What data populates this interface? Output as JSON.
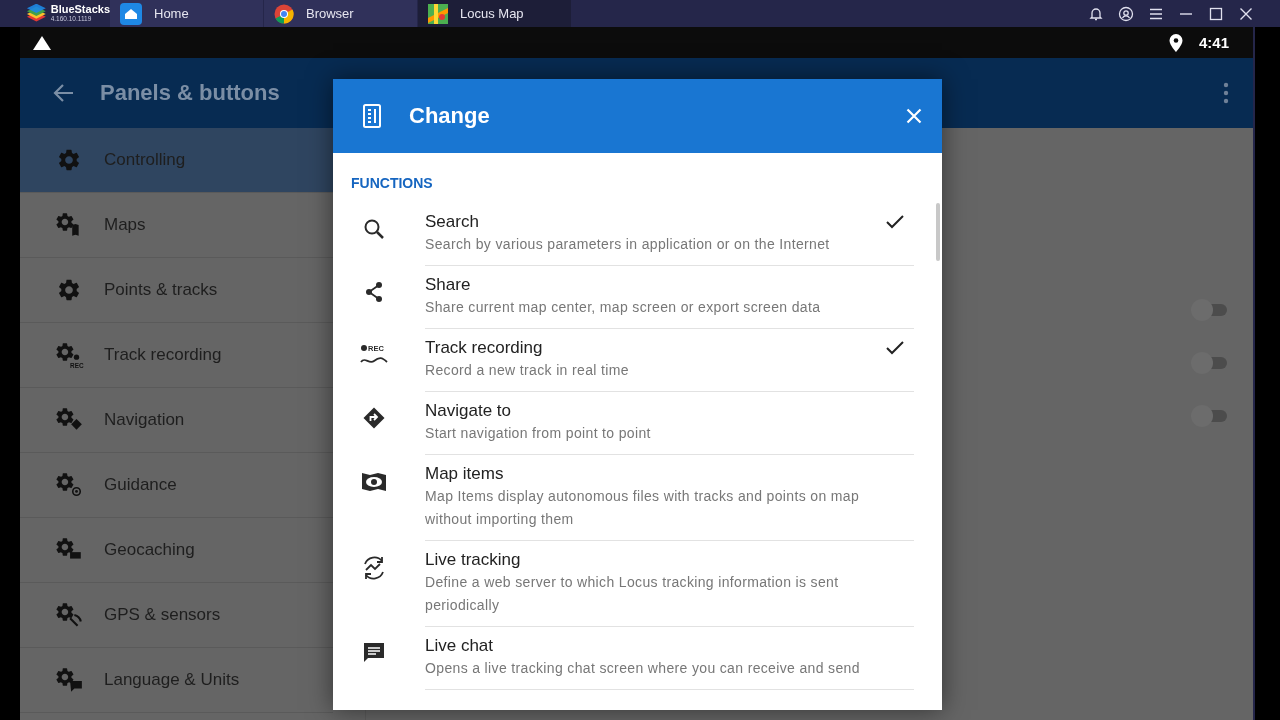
{
  "emulator": {
    "app_name": "BlueStacks",
    "version": "4.160.10.1119",
    "tabs": [
      {
        "label": "Home",
        "selected": false
      },
      {
        "label": "Browser",
        "selected": false
      },
      {
        "label": "Locus Map",
        "selected": true
      }
    ]
  },
  "status_bar": {
    "time": "4:41"
  },
  "app_bar": {
    "title": "Panels & buttons"
  },
  "sidebar": {
    "items": [
      {
        "label": "Controlling",
        "selected": true
      },
      {
        "label": "Maps",
        "selected": false
      },
      {
        "label": "Points & tracks",
        "selected": false
      },
      {
        "label": "Track recording",
        "selected": false,
        "badge": "REC"
      },
      {
        "label": "Navigation",
        "selected": false
      },
      {
        "label": "Guidance",
        "selected": false
      },
      {
        "label": "Geocaching",
        "selected": false
      },
      {
        "label": "GPS & sensors",
        "selected": false
      },
      {
        "label": "Language & Units",
        "selected": false
      }
    ]
  },
  "toggles": [
    {
      "on": false
    },
    {
      "on": false
    },
    {
      "on": false
    }
  ],
  "dialog": {
    "title": "Change",
    "section": "FUNCTIONS",
    "items": [
      {
        "title": "Search",
        "description": "Search by various parameters in application or on the Internet",
        "checked": true
      },
      {
        "title": "Share",
        "description": "Share current map center, map screen or export screen data",
        "checked": false
      },
      {
        "title": "Track recording",
        "description": "Record a new track in real time",
        "checked": true,
        "badge": "REC"
      },
      {
        "title": "Navigate to",
        "description": "Start navigation from point to point",
        "checked": false
      },
      {
        "title": "Map items",
        "description": "Map Items display autonomous files with tracks and points on map without importing them",
        "checked": false
      },
      {
        "title": "Live tracking",
        "description": "Define a web server to which Locus tracking information is sent periodically",
        "checked": false
      },
      {
        "title": "Live chat",
        "description": "Opens a live tracking chat screen where you can receive and send",
        "checked": false
      }
    ]
  }
}
